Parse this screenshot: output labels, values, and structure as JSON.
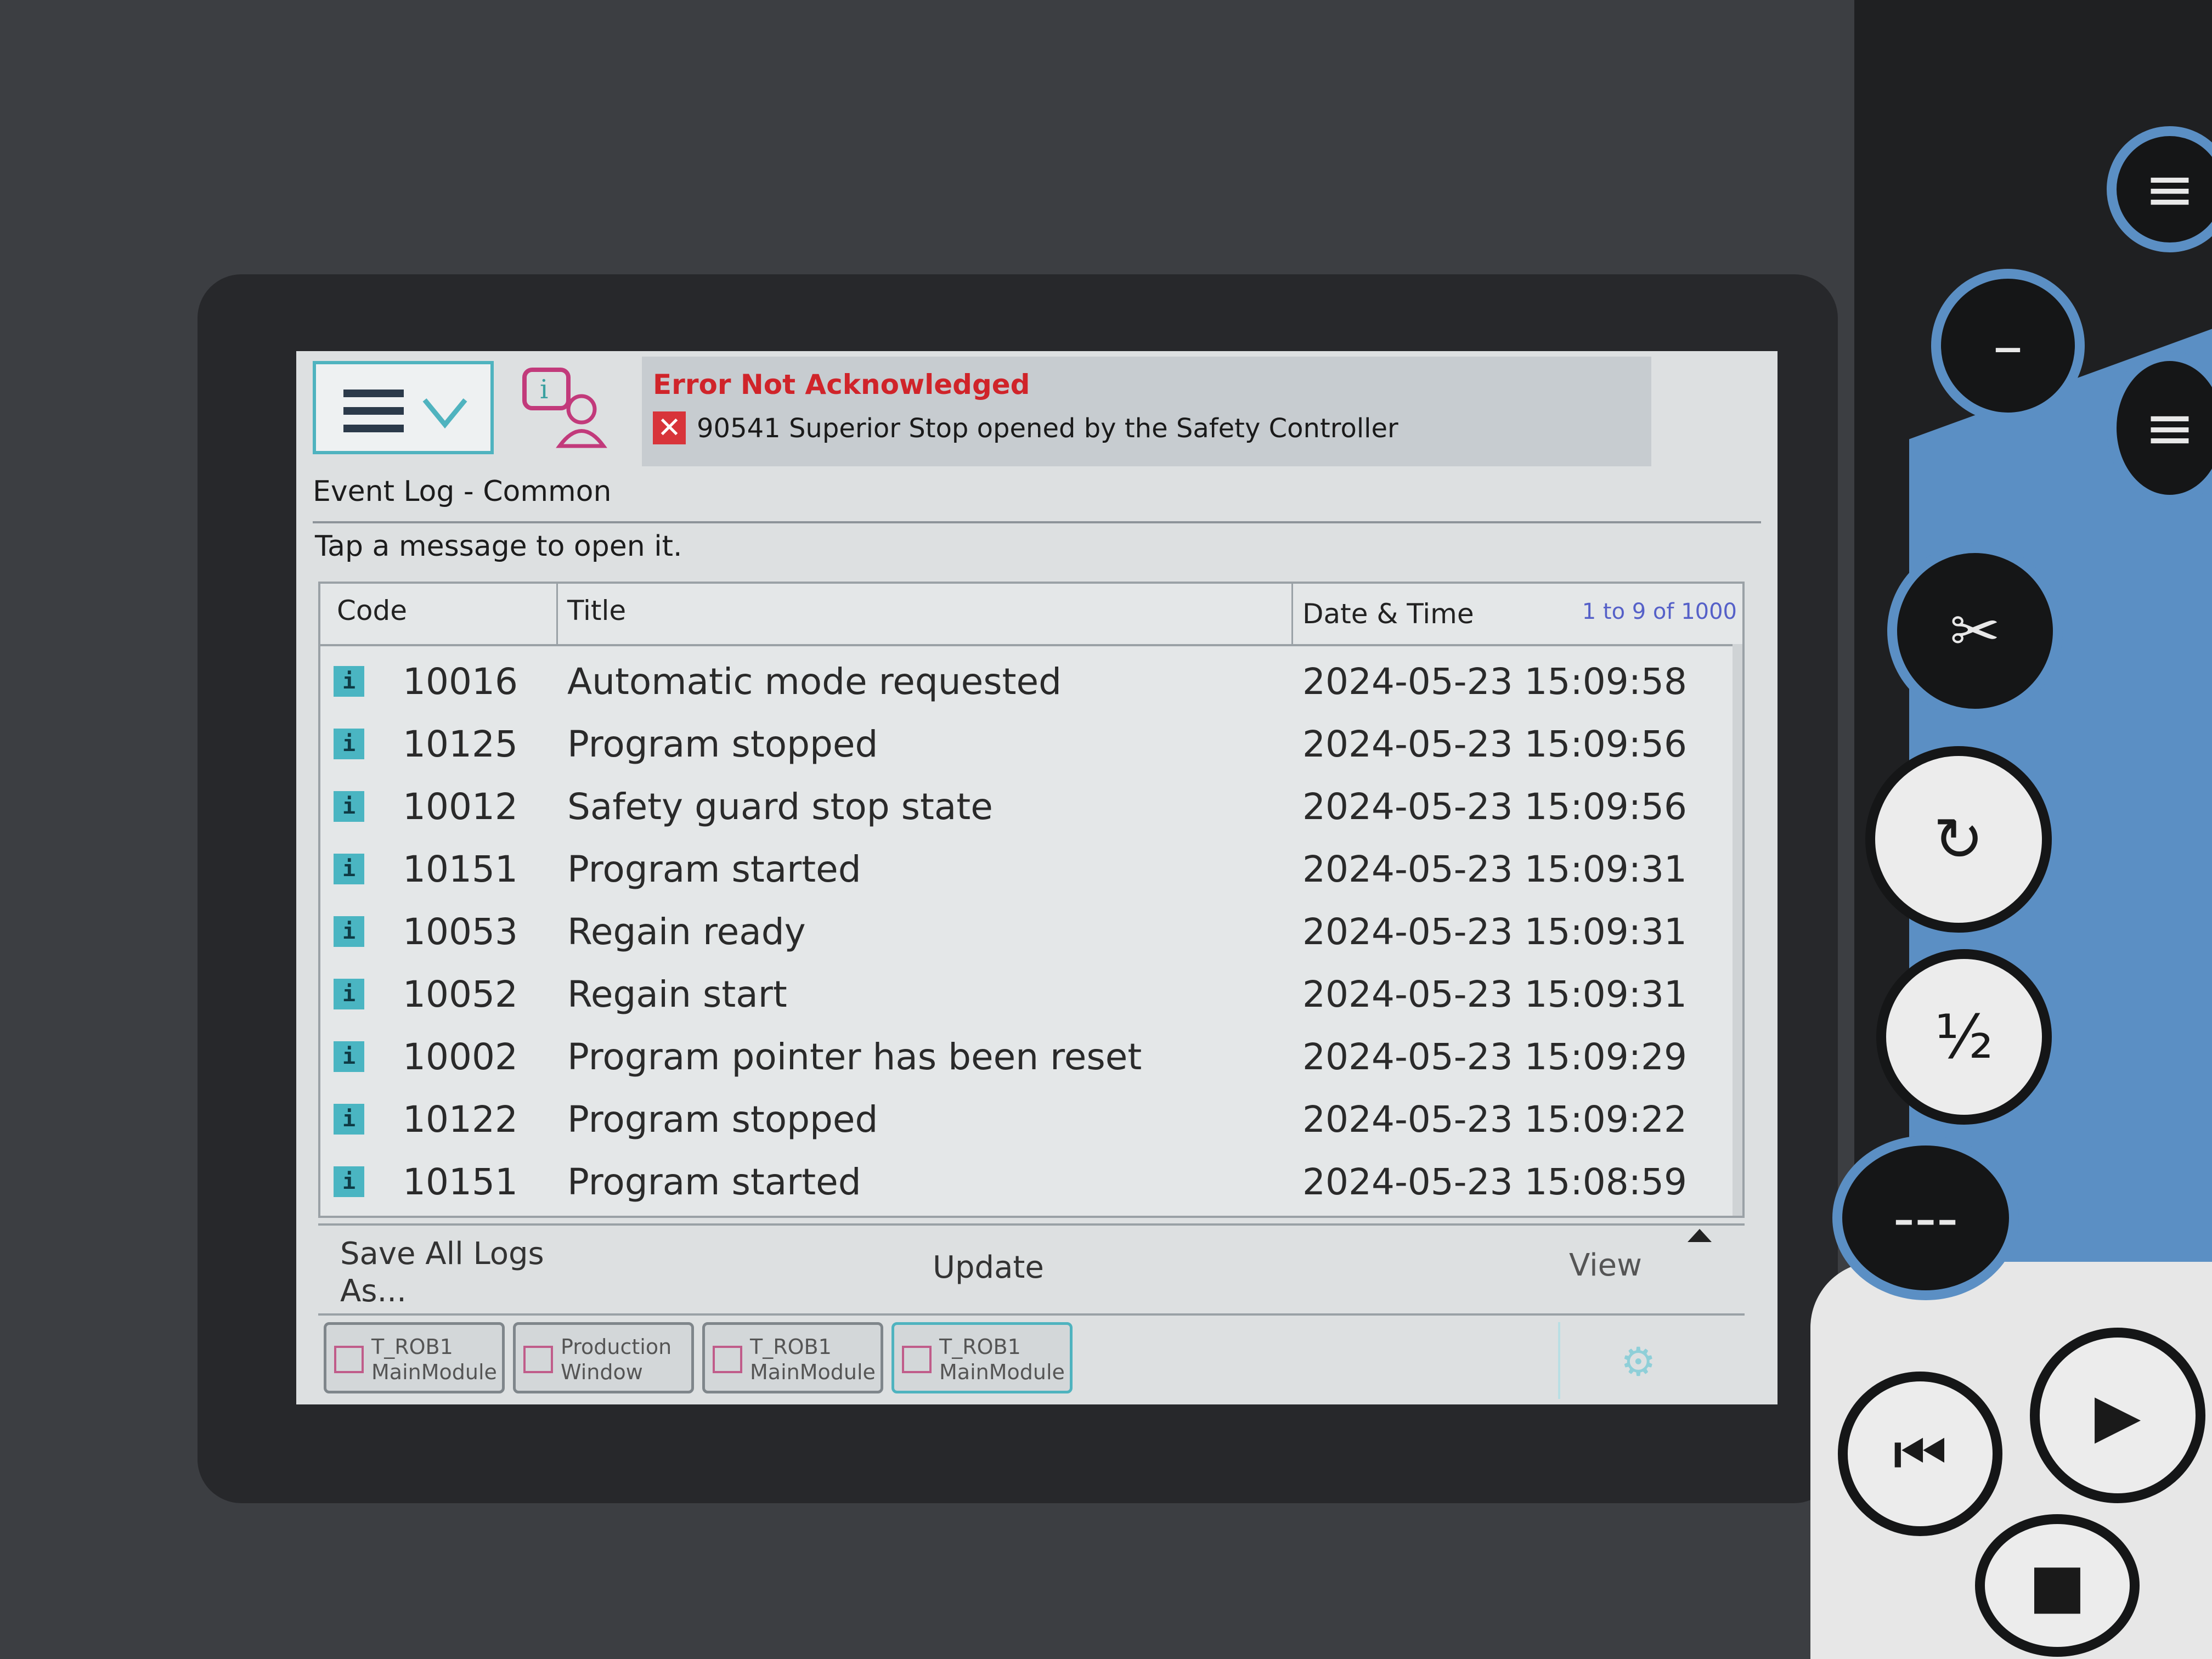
{
  "header": {
    "alert_title": "Error Not Acknowledged",
    "alert_message": "90541 Superior Stop opened by the Safety Controller"
  },
  "page": {
    "title": "Event Log - Common",
    "hint": "Tap a message to open it."
  },
  "table": {
    "columns": {
      "code": "Code",
      "title": "Title",
      "datetime": "Date & Time"
    },
    "range": "1 to 9 of 1000",
    "rows": [
      {
        "code": "10016",
        "title": "Automatic mode requested",
        "datetime": "2024-05-23 15:09:58"
      },
      {
        "code": "10125",
        "title": "Program stopped",
        "datetime": "2024-05-23 15:09:56"
      },
      {
        "code": "10012",
        "title": "Safety guard stop state",
        "datetime": "2024-05-23 15:09:56"
      },
      {
        "code": "10151",
        "title": "Program started",
        "datetime": "2024-05-23 15:09:31"
      },
      {
        "code": "10053",
        "title": "Regain ready",
        "datetime": "2024-05-23 15:09:31"
      },
      {
        "code": "10052",
        "title": "Regain start",
        "datetime": "2024-05-23 15:09:31"
      },
      {
        "code": "10002",
        "title": "Program pointer has been reset",
        "datetime": "2024-05-23 15:09:29"
      },
      {
        "code": "10122",
        "title": "Program stopped",
        "datetime": "2024-05-23 15:09:22"
      },
      {
        "code": "10151",
        "title": "Program started",
        "datetime": "2024-05-23 15:08:59"
      }
    ]
  },
  "commands": {
    "save_line1": "Save All Logs",
    "save_line2": "As...",
    "update": "Update",
    "view": "View"
  },
  "taskbar": [
    {
      "line1": "T_ROB1",
      "line2": "MainModule",
      "active": false
    },
    {
      "line1": "Production",
      "line2": "Window",
      "active": false
    },
    {
      "line1": "T_ROB1",
      "line2": "MainModule",
      "active": false
    },
    {
      "line1": "T_ROB1",
      "line2": "MainModule",
      "active": true
    }
  ],
  "icons": {
    "menu": "hamburger-menu-icon",
    "event_log": "event-log-icon",
    "error": "error-x-icon",
    "row": "info-icon",
    "quickset": "gear-icon"
  },
  "colors": {
    "accent": "#4fb3bf",
    "error": "#d0242a",
    "range": "#5560c8"
  }
}
